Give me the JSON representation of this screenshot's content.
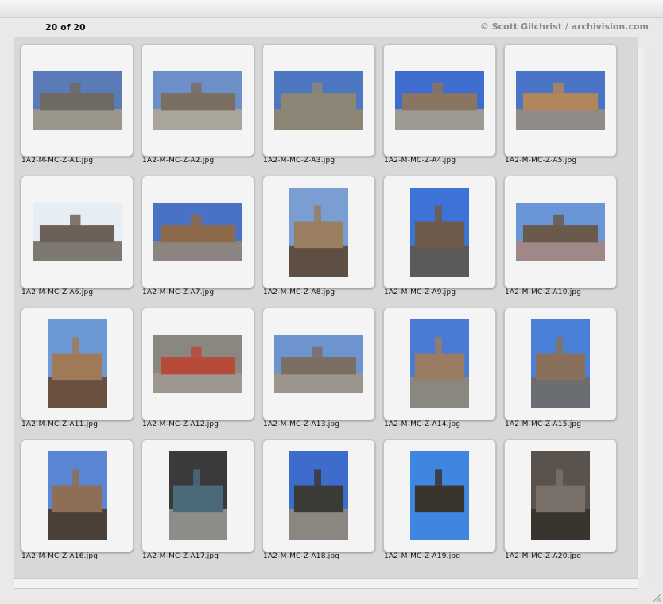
{
  "header": {
    "count": "20 of 20",
    "copyright": "© Scott Gilchrist / archivision.com"
  },
  "slides": [
    {
      "filename": "1A2-M-MC-Z-A1.jpg",
      "orientation": "landscape",
      "sky": "#5a7ab8",
      "ground": "#9a968c",
      "subject": "#6e6a62"
    },
    {
      "filename": "1A2-M-MC-Z-A2.jpg",
      "orientation": "landscape",
      "sky": "#6c8fc8",
      "ground": "#a9a59a",
      "subject": "#7a6e60"
    },
    {
      "filename": "1A2-M-MC-Z-A3.jpg",
      "orientation": "landscape",
      "sky": "#4e77c2",
      "ground": "#8c8474",
      "subject": "#8d8576"
    },
    {
      "filename": "1A2-M-MC-Z-A4.jpg",
      "orientation": "landscape",
      "sky": "#3f6ccf",
      "ground": "#9d9a94",
      "subject": "#8a7462"
    },
    {
      "filename": "1A2-M-MC-Z-A5.jpg",
      "orientation": "landscape",
      "sky": "#4a74c6",
      "ground": "#8f8b86",
      "subject": "#b0865a"
    },
    {
      "filename": "1A2-M-MC-Z-A6.jpg",
      "orientation": "landscape",
      "sky": "#e6eef4",
      "ground": "#7d7972",
      "subject": "#6d6058"
    },
    {
      "filename": "1A2-M-MC-Z-A7.jpg",
      "orientation": "landscape",
      "sky": "#4a72c4",
      "ground": "#8c8480",
      "subject": "#8e6a4a"
    },
    {
      "filename": "1A2-M-MC-Z-A8.jpg",
      "orientation": "portrait",
      "sky": "#7a9ed2",
      "ground": "#5e4e44",
      "subject": "#9a7e60"
    },
    {
      "filename": "1A2-M-MC-Z-A9.jpg",
      "orientation": "portrait",
      "sky": "#3d73d6",
      "ground": "#5a5a5a",
      "subject": "#6e5a4a"
    },
    {
      "filename": "1A2-M-MC-Z-A10.jpg",
      "orientation": "landscape",
      "sky": "#6a96d8",
      "ground": "#a08888",
      "subject": "#6a5a4c"
    },
    {
      "filename": "1A2-M-MC-Z-A11.jpg",
      "orientation": "portrait",
      "sky": "#6c98d6",
      "ground": "#6a5040",
      "subject": "#a07a58"
    },
    {
      "filename": "1A2-M-MC-Z-A12.jpg",
      "orientation": "landscape",
      "sky": "#8a8680",
      "ground": "#9c9890",
      "subject": "#b84a3a"
    },
    {
      "filename": "1A2-M-MC-Z-A13.jpg",
      "orientation": "landscape",
      "sky": "#6e94d0",
      "ground": "#9a968e",
      "subject": "#7a6e62"
    },
    {
      "filename": "1A2-M-MC-Z-A14.jpg",
      "orientation": "portrait",
      "sky": "#4a7ad4",
      "ground": "#8a8680",
      "subject": "#9a7c62"
    },
    {
      "filename": "1A2-M-MC-Z-A15.jpg",
      "orientation": "portrait",
      "sky": "#4a80d8",
      "ground": "#6a6e72",
      "subject": "#8a705a"
    },
    {
      "filename": "1A2-M-MC-Z-A16.jpg",
      "orientation": "portrait",
      "sky": "#5a86d4",
      "ground": "#4a4038",
      "subject": "#8e6e56"
    },
    {
      "filename": "1A2-M-MC-Z-A17.jpg",
      "orientation": "portrait",
      "sky": "#3a3a3a",
      "ground": "#8e8c88",
      "subject": "#4a6a7a"
    },
    {
      "filename": "1A2-M-MC-Z-A18.jpg",
      "orientation": "portrait",
      "sky": "#3e6ccc",
      "ground": "#8a8680",
      "subject": "#3a3a36"
    },
    {
      "filename": "1A2-M-MC-Z-A19.jpg",
      "orientation": "portrait",
      "sky": "#3e86e0",
      "ground": "#3e86e0",
      "subject": "#3a342e"
    },
    {
      "filename": "1A2-M-MC-Z-A20.jpg",
      "orientation": "portrait",
      "sky": "#5a524c",
      "ground": "#3a342e",
      "subject": "#7a706a"
    }
  ],
  "colors": {
    "panel": "#d8d8d8",
    "slide": "#f4f4f4",
    "copyright": "#8a8a8a"
  }
}
